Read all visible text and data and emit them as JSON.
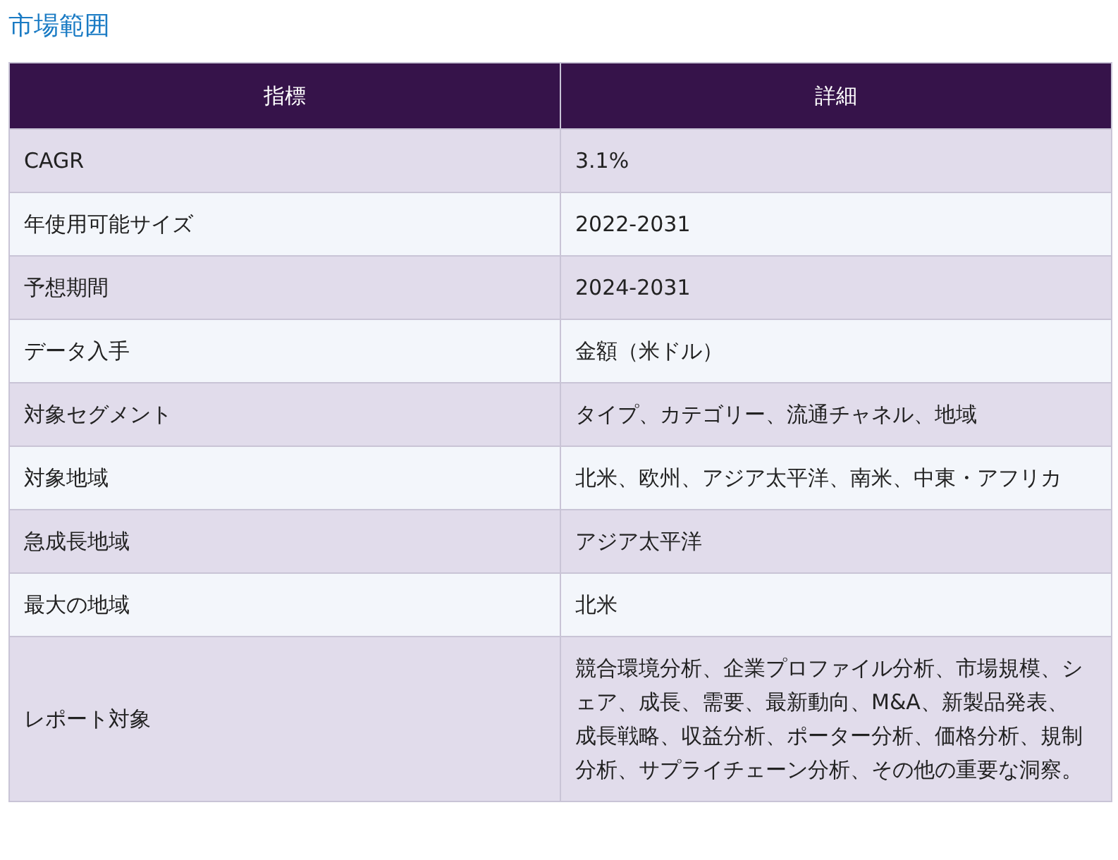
{
  "title": "市場範囲",
  "table": {
    "columns": [
      "指標",
      "詳細"
    ],
    "rows": [
      {
        "metric": "CAGR",
        "detail": "3.1%"
      },
      {
        "metric": "年使用可能サイズ",
        "detail": "2022-2031"
      },
      {
        "metric": "予想期間",
        "detail": "2024-2031"
      },
      {
        "metric": "データ入手",
        "detail": "金額（米ドル）"
      },
      {
        "metric": "対象セグメント",
        "detail": "タイプ、カテゴリー、流通チャネル、地域"
      },
      {
        "metric": "対象地域",
        "detail": "北米、欧州、アジア太平洋、南米、中東・アフリカ"
      },
      {
        "metric": "急成長地域",
        "detail": "アジア太平洋"
      },
      {
        "metric": "最大の地域",
        "detail": "北米"
      },
      {
        "metric": "レポート対象",
        "detail": "競合環境分析、企業プロファイル分析、市場規模、シェア、成長、需要、最新動向、M&A、新製品発表、成長戦略、収益分析、ポーター分析、価格分析、規制分析、サプライチェーン分析、その他の重要な洞察。"
      }
    ]
  }
}
